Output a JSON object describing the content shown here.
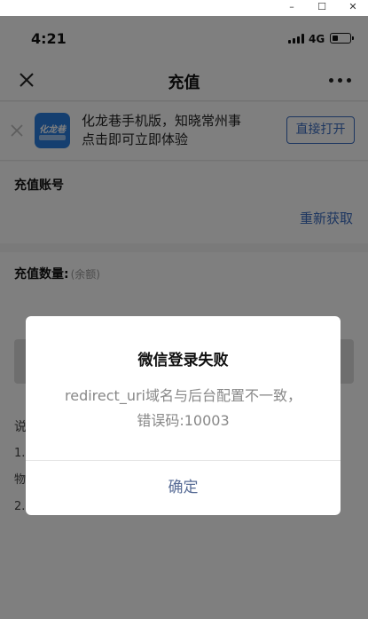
{
  "window": {
    "minimize_glyph": "–",
    "maximize_glyph": "☐",
    "close_glyph": "✕"
  },
  "status_bar": {
    "time": "4:21",
    "network": "4G"
  },
  "nav": {
    "title": "充值",
    "close_icon": "close-icon",
    "more_icon": "more-icon"
  },
  "banner": {
    "app_name_logo": "化龙巷",
    "line1": "化龙巷手机版，知晓常州事",
    "line2": "点击即可立即体验",
    "open_button": "直接打开"
  },
  "account": {
    "label": "充值账号",
    "refetch": "重新获取"
  },
  "amount": {
    "label": "充值数量:",
    "hint": "(余额)"
  },
  "notes": {
    "title": "说",
    "lines": [
      "1.内",
      "物",
      "2."
    ]
  },
  "dialog": {
    "title": "微信登录失败",
    "message": "redirect_uri域名与后台配置不一致，错误码:10003",
    "confirm": "确定"
  },
  "colors": {
    "link_blue": "#3a6cc0",
    "dialog_button": "#576b95",
    "overlay": "rgba(0,0,0,0.5)"
  }
}
